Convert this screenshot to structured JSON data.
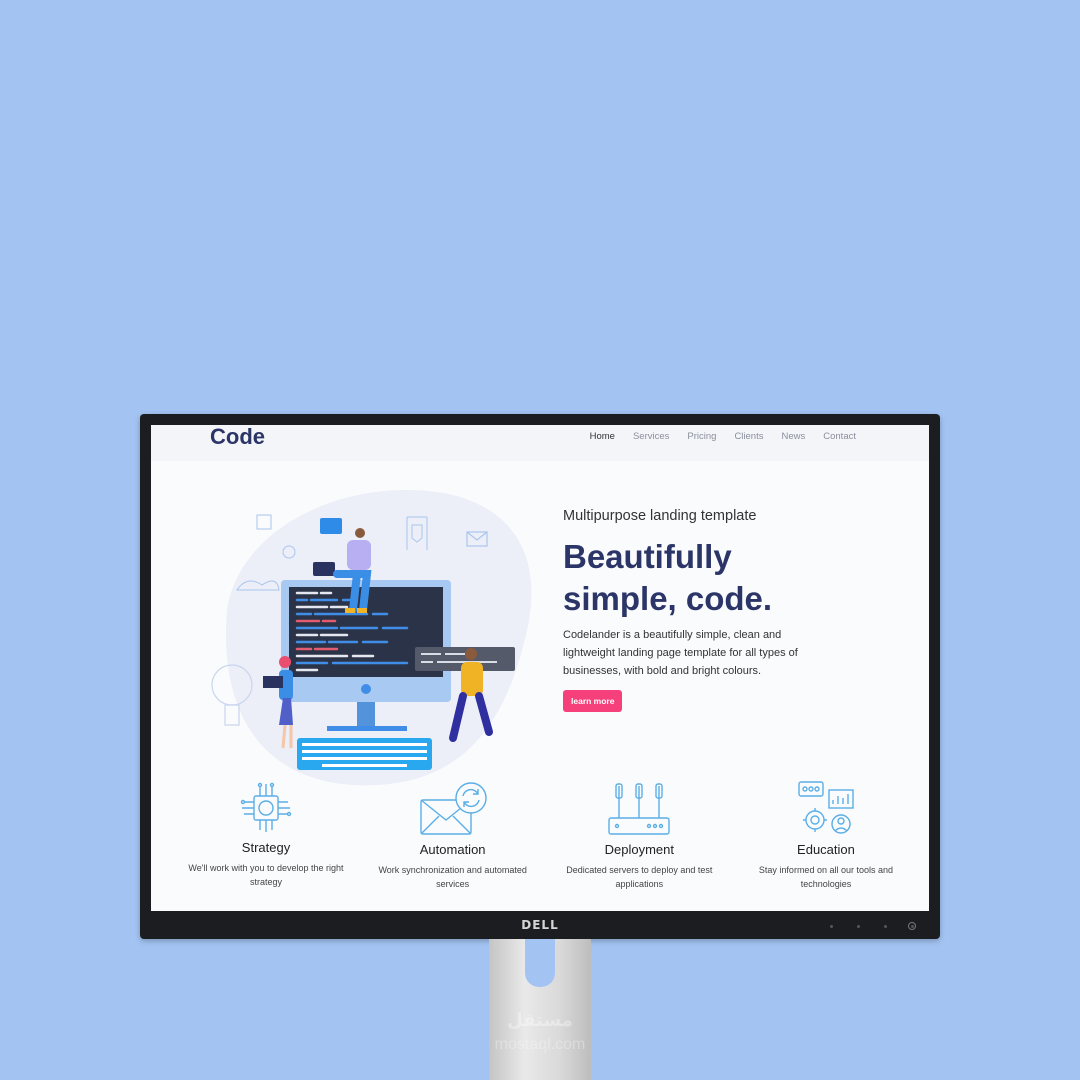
{
  "brand": {
    "logo": "Code"
  },
  "nav": {
    "items": [
      {
        "label": "Home",
        "active": true
      },
      {
        "label": "Services"
      },
      {
        "label": "Pricing"
      },
      {
        "label": "Clients"
      },
      {
        "label": "News"
      },
      {
        "label": "Contact"
      }
    ]
  },
  "hero": {
    "subtitle": "Multipurpose landing template",
    "headline_line1": "Beautifully",
    "headline_line2": "simple, code.",
    "description": "Codelander is a beautifully simple, clean and lightweight landing page template for all types of businesses, with bold and bright colours.",
    "button_label": "learn more"
  },
  "features": [
    {
      "icon": "chip-icon",
      "title": "Strategy",
      "description": "We'll work with you to develop the right strategy"
    },
    {
      "icon": "mail-sync-icon",
      "title": "Automation",
      "description": "Work synchronization and automated services"
    },
    {
      "icon": "router-icon",
      "title": "Deployment",
      "description": "Dedicated servers to deploy and test applications"
    },
    {
      "icon": "education-icon",
      "title": "Education",
      "description": "Stay informed on all our tools and technologies"
    }
  ],
  "monitor": {
    "brand": "DELL"
  },
  "watermark": {
    "line1": "مستقل",
    "line2": "mostaql.com"
  },
  "colors": {
    "background": "#a3c4f3",
    "primary": "#2c3568",
    "accent": "#f5407c",
    "icon": "#5aaee6"
  }
}
